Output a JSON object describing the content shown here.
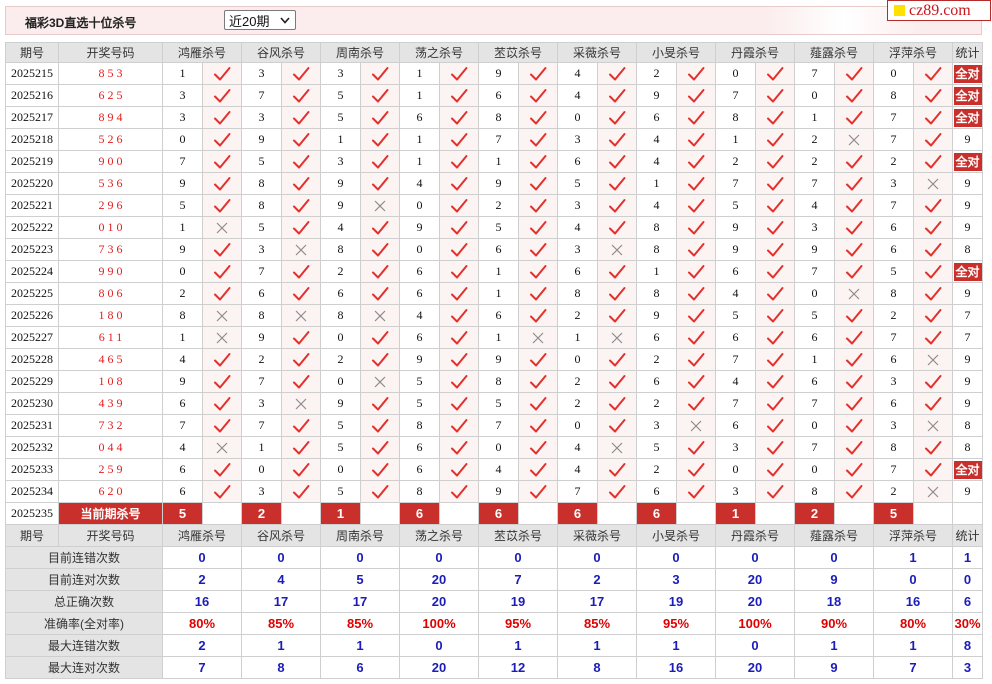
{
  "header": {
    "title": "福彩3D直选十位杀号",
    "period_select": {
      "selected": "近20期"
    }
  },
  "logo": {
    "text": "cz89.com"
  },
  "colors": {
    "accent_red": "#c9302c",
    "check": "#e2312c",
    "cross": "#8c8c8c",
    "draw_number": "#e02020",
    "stat_value": "#1c1cb8",
    "accuracy_value": "#e00000",
    "logo_square": "#ffe100"
  },
  "columns": {
    "period": "期号",
    "draw_number": "开奖号码",
    "experts": [
      "鸿雁杀号",
      "谷风杀号",
      "周南杀号",
      "荡之杀号",
      "苤苡杀号",
      "采薇杀号",
      "小旻杀号",
      "丹霞杀号",
      "薤露杀号",
      "浮萍杀号"
    ],
    "stats": "统计"
  },
  "rows": [
    {
      "period": "2025215",
      "draw": "853",
      "kills": [
        "1",
        "3",
        "3",
        "1",
        "9",
        "4",
        "2",
        "0",
        "7",
        "0"
      ],
      "hits": [
        true,
        true,
        true,
        true,
        true,
        true,
        true,
        true,
        true,
        true
      ],
      "stat": "全对"
    },
    {
      "period": "2025216",
      "draw": "625",
      "kills": [
        "3",
        "7",
        "5",
        "1",
        "6",
        "4",
        "9",
        "7",
        "0",
        "8"
      ],
      "hits": [
        true,
        true,
        true,
        true,
        true,
        true,
        true,
        true,
        true,
        true
      ],
      "stat": "全对"
    },
    {
      "period": "2025217",
      "draw": "894",
      "kills": [
        "3",
        "3",
        "5",
        "6",
        "8",
        "0",
        "6",
        "8",
        "1",
        "7"
      ],
      "hits": [
        true,
        true,
        true,
        true,
        true,
        true,
        true,
        true,
        true,
        true
      ],
      "stat": "全对"
    },
    {
      "period": "2025218",
      "draw": "526",
      "kills": [
        "0",
        "9",
        "1",
        "1",
        "7",
        "3",
        "4",
        "1",
        "2",
        "7"
      ],
      "hits": [
        true,
        true,
        true,
        true,
        true,
        true,
        true,
        true,
        false,
        true
      ],
      "stat": "9"
    },
    {
      "period": "2025219",
      "draw": "900",
      "kills": [
        "7",
        "5",
        "3",
        "1",
        "1",
        "6",
        "4",
        "2",
        "2",
        "2"
      ],
      "hits": [
        true,
        true,
        true,
        true,
        true,
        true,
        true,
        true,
        true,
        true
      ],
      "stat": "全对"
    },
    {
      "period": "2025220",
      "draw": "536",
      "kills": [
        "9",
        "8",
        "9",
        "4",
        "9",
        "5",
        "1",
        "7",
        "7",
        "3"
      ],
      "hits": [
        true,
        true,
        true,
        true,
        true,
        true,
        true,
        true,
        true,
        false
      ],
      "stat": "9"
    },
    {
      "period": "2025221",
      "draw": "296",
      "kills": [
        "5",
        "8",
        "9",
        "0",
        "2",
        "3",
        "4",
        "5",
        "4",
        "7"
      ],
      "hits": [
        true,
        true,
        false,
        true,
        true,
        true,
        true,
        true,
        true,
        true
      ],
      "stat": "9"
    },
    {
      "period": "2025222",
      "draw": "010",
      "kills": [
        "1",
        "5",
        "4",
        "9",
        "5",
        "4",
        "8",
        "9",
        "3",
        "6"
      ],
      "hits": [
        false,
        true,
        true,
        true,
        true,
        true,
        true,
        true,
        true,
        true
      ],
      "stat": "9"
    },
    {
      "period": "2025223",
      "draw": "736",
      "kills": [
        "9",
        "3",
        "8",
        "0",
        "6",
        "3",
        "8",
        "9",
        "9",
        "6"
      ],
      "hits": [
        true,
        false,
        true,
        true,
        true,
        false,
        true,
        true,
        true,
        true
      ],
      "stat": "8"
    },
    {
      "period": "2025224",
      "draw": "990",
      "kills": [
        "0",
        "7",
        "2",
        "6",
        "1",
        "6",
        "1",
        "6",
        "7",
        "5"
      ],
      "hits": [
        true,
        true,
        true,
        true,
        true,
        true,
        true,
        true,
        true,
        true
      ],
      "stat": "全对"
    },
    {
      "period": "2025225",
      "draw": "806",
      "kills": [
        "2",
        "6",
        "6",
        "6",
        "1",
        "8",
        "8",
        "4",
        "0",
        "8"
      ],
      "hits": [
        true,
        true,
        true,
        true,
        true,
        true,
        true,
        true,
        false,
        true
      ],
      "stat": "9"
    },
    {
      "period": "2025226",
      "draw": "180",
      "kills": [
        "8",
        "8",
        "8",
        "4",
        "6",
        "2",
        "9",
        "5",
        "5",
        "2"
      ],
      "hits": [
        false,
        false,
        false,
        true,
        true,
        true,
        true,
        true,
        true,
        true
      ],
      "stat": "7"
    },
    {
      "period": "2025227",
      "draw": "611",
      "kills": [
        "1",
        "9",
        "0",
        "6",
        "1",
        "1",
        "6",
        "6",
        "6",
        "7"
      ],
      "hits": [
        false,
        true,
        true,
        true,
        false,
        false,
        true,
        true,
        true,
        true
      ],
      "stat": "7"
    },
    {
      "period": "2025228",
      "draw": "465",
      "kills": [
        "4",
        "2",
        "2",
        "9",
        "9",
        "0",
        "2",
        "7",
        "1",
        "6"
      ],
      "hits": [
        true,
        true,
        true,
        true,
        true,
        true,
        true,
        true,
        true,
        false
      ],
      "stat": "9"
    },
    {
      "period": "2025229",
      "draw": "108",
      "kills": [
        "9",
        "7",
        "0",
        "5",
        "8",
        "2",
        "6",
        "4",
        "6",
        "3"
      ],
      "hits": [
        true,
        true,
        false,
        true,
        true,
        true,
        true,
        true,
        true,
        true
      ],
      "stat": "9"
    },
    {
      "period": "2025230",
      "draw": "439",
      "kills": [
        "6",
        "3",
        "9",
        "5",
        "5",
        "2",
        "2",
        "7",
        "7",
        "6"
      ],
      "hits": [
        true,
        false,
        true,
        true,
        true,
        true,
        true,
        true,
        true,
        true
      ],
      "stat": "9"
    },
    {
      "period": "2025231",
      "draw": "732",
      "kills": [
        "7",
        "7",
        "5",
        "8",
        "7",
        "0",
        "3",
        "6",
        "0",
        "3"
      ],
      "hits": [
        true,
        true,
        true,
        true,
        true,
        true,
        false,
        true,
        true,
        false
      ],
      "stat": "8"
    },
    {
      "period": "2025232",
      "draw": "044",
      "kills": [
        "4",
        "1",
        "5",
        "6",
        "0",
        "4",
        "5",
        "3",
        "7",
        "8"
      ],
      "hits": [
        false,
        true,
        true,
        true,
        true,
        false,
        true,
        true,
        true,
        true
      ],
      "stat": "8"
    },
    {
      "period": "2025233",
      "draw": "259",
      "kills": [
        "6",
        "0",
        "0",
        "6",
        "4",
        "4",
        "2",
        "0",
        "0",
        "7"
      ],
      "hits": [
        true,
        true,
        true,
        true,
        true,
        true,
        true,
        true,
        true,
        true
      ],
      "stat": "全对"
    },
    {
      "period": "2025234",
      "draw": "620",
      "kills": [
        "6",
        "3",
        "5",
        "8",
        "9",
        "7",
        "6",
        "3",
        "8",
        "2"
      ],
      "hits": [
        true,
        true,
        true,
        true,
        true,
        true,
        true,
        true,
        true,
        false
      ],
      "stat": "9"
    }
  ],
  "current": {
    "period": "2025235",
    "label": "当前期杀号",
    "kills": [
      "5",
      "2",
      "1",
      "6",
      "6",
      "6",
      "6",
      "1",
      "2",
      "5"
    ]
  },
  "summary": [
    {
      "label": "目前连错次数",
      "values": [
        "0",
        "0",
        "0",
        "0",
        "0",
        "0",
        "0",
        "0",
        "0",
        "1",
        "1"
      ],
      "color": "stat_value"
    },
    {
      "label": "目前连对次数",
      "values": [
        "2",
        "4",
        "5",
        "20",
        "7",
        "2",
        "3",
        "20",
        "9",
        "0",
        "0"
      ],
      "color": "stat_value"
    },
    {
      "label": "总正确次数",
      "values": [
        "16",
        "17",
        "17",
        "20",
        "19",
        "17",
        "19",
        "20",
        "18",
        "16",
        "6"
      ],
      "color": "stat_value"
    },
    {
      "label": "准确率(全对率)",
      "values": [
        "80%",
        "85%",
        "85%",
        "100%",
        "95%",
        "85%",
        "95%",
        "100%",
        "90%",
        "80%",
        "30%"
      ],
      "color": "accuracy_value"
    },
    {
      "label": "最大连错次数",
      "values": [
        "2",
        "1",
        "1",
        "0",
        "1",
        "1",
        "1",
        "0",
        "1",
        "1",
        "8"
      ],
      "color": "stat_value"
    },
    {
      "label": "最大连对次数",
      "values": [
        "7",
        "8",
        "6",
        "20",
        "12",
        "8",
        "16",
        "20",
        "9",
        "7",
        "3"
      ],
      "color": "stat_value"
    }
  ]
}
